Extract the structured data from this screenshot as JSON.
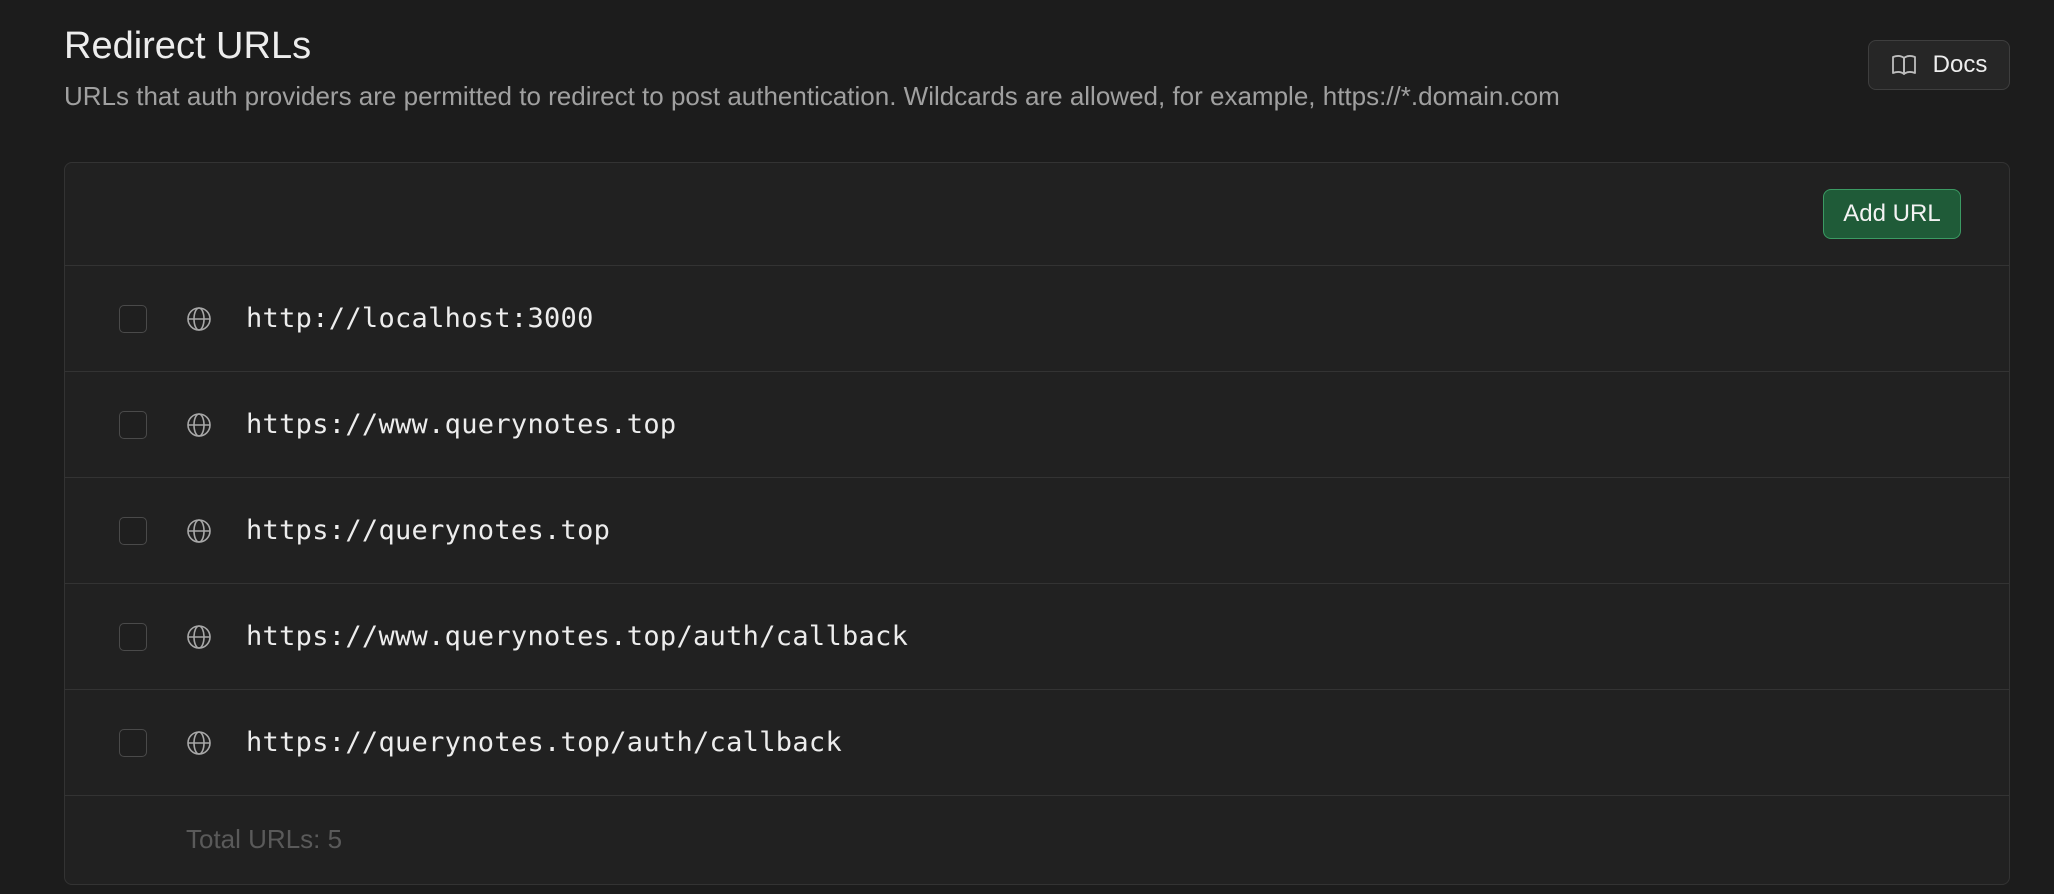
{
  "header": {
    "title": "Redirect URLs",
    "subtitle": "URLs that auth providers are permitted to redirect to post authentication. Wildcards are allowed, for example, https://*.domain.com",
    "docs_label": "Docs",
    "docs_icon": "book-icon"
  },
  "toolbar": {
    "add_label": "Add URL"
  },
  "urls": [
    {
      "url": "http://localhost:3000",
      "icon": "globe-icon",
      "checked": false
    },
    {
      "url": "https://www.querynotes.top",
      "icon": "globe-icon",
      "checked": false
    },
    {
      "url": "https://querynotes.top",
      "icon": "globe-icon",
      "checked": false
    },
    {
      "url": "https://www.querynotes.top/auth/callback",
      "icon": "globe-icon",
      "checked": false
    },
    {
      "url": "https://querynotes.top/auth/callback",
      "icon": "globe-icon",
      "checked": false
    }
  ],
  "footer": {
    "total_label": "Total URLs: 5"
  },
  "colors": {
    "background": "#1c1c1c",
    "panel": "#212121",
    "accent_button": "#1f5b38",
    "accent_border": "#3b9a63"
  }
}
